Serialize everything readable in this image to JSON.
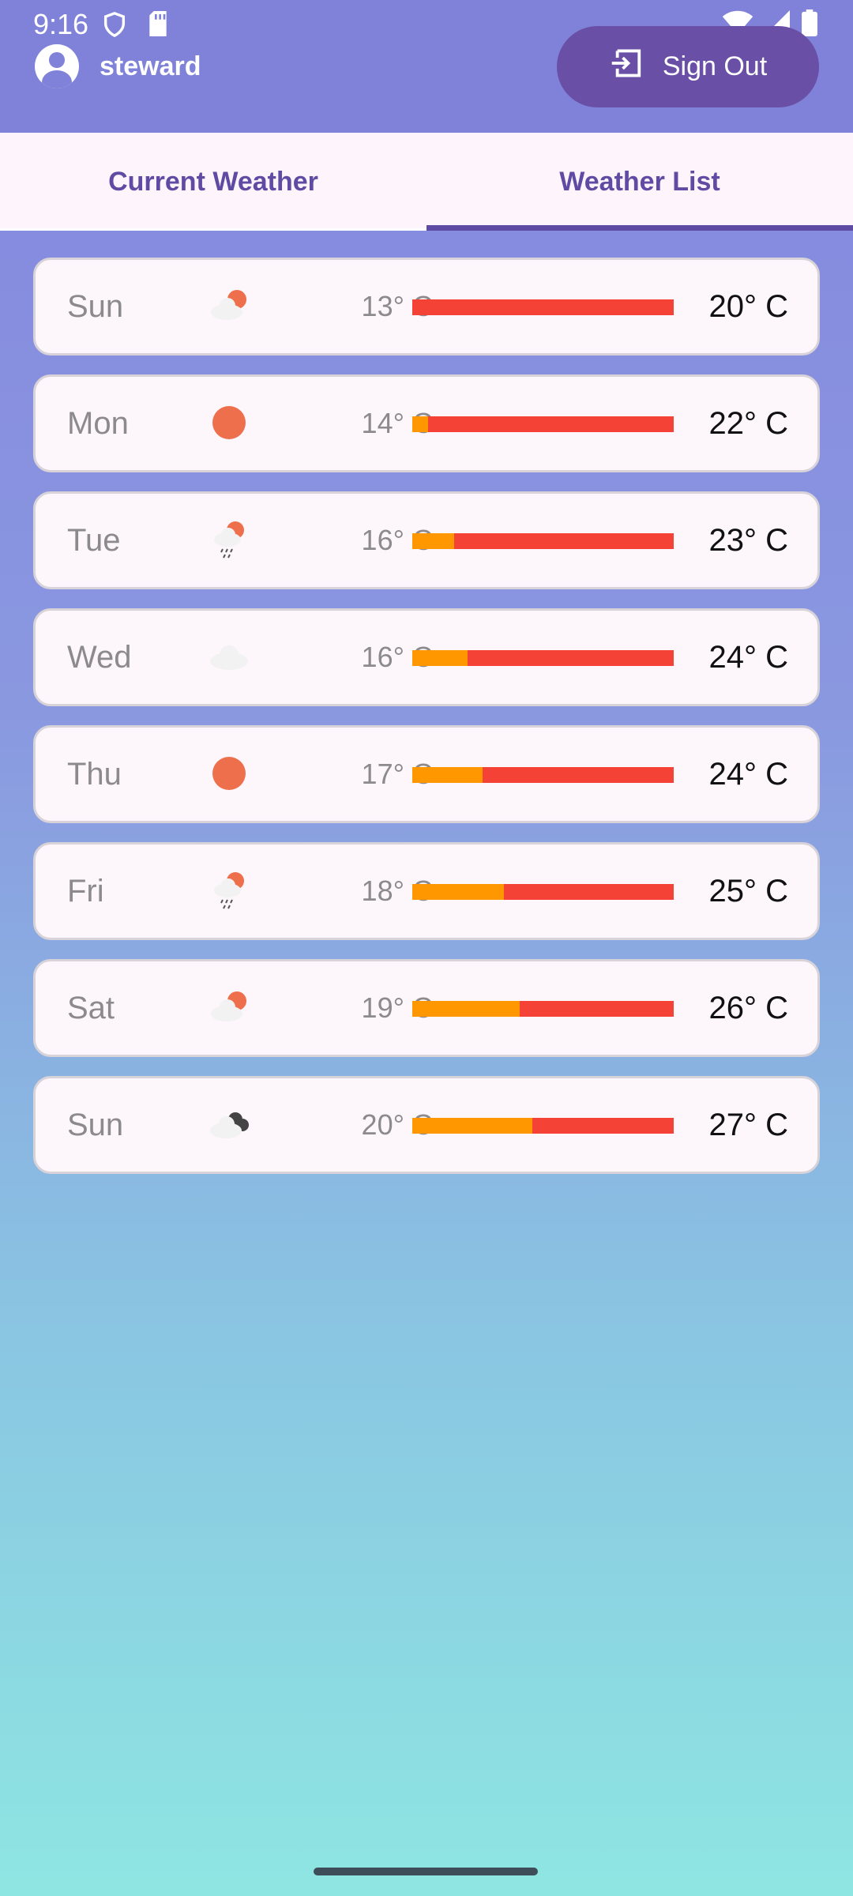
{
  "status_bar": {
    "time": "9:16",
    "icons": [
      "shield-icon",
      "sd-card-icon",
      "wifi-icon",
      "signal-icon",
      "battery-icon"
    ]
  },
  "header": {
    "username": "steward",
    "sign_out_label": "Sign Out"
  },
  "tabs": [
    {
      "label": "Current Weather",
      "selected": false
    },
    {
      "label": "Weather List",
      "selected": true
    }
  ],
  "colors": {
    "accent": "#5F4BA3",
    "bar_high": "#F44336",
    "bar_low": "#FF9800"
  },
  "forecast": [
    {
      "day": "Sun",
      "icon": "partly-cloudy-icon",
      "low": "13° C",
      "high": "20° C",
      "low_fraction": 0.0
    },
    {
      "day": "Mon",
      "icon": "sun-icon",
      "low": "14° C",
      "high": "22° C",
      "low_fraction": 0.06
    },
    {
      "day": "Tue",
      "icon": "rain-sun-icon",
      "low": "16° C",
      "high": "23° C",
      "low_fraction": 0.16
    },
    {
      "day": "Wed",
      "icon": "cloud-icon",
      "low": "16° C",
      "high": "24° C",
      "low_fraction": 0.21
    },
    {
      "day": "Thu",
      "icon": "sun-icon",
      "low": "17° C",
      "high": "24° C",
      "low_fraction": 0.27
    },
    {
      "day": "Fri",
      "icon": "rain-sun-icon",
      "low": "18° C",
      "high": "25° C",
      "low_fraction": 0.35
    },
    {
      "day": "Sat",
      "icon": "partly-cloudy-icon",
      "low": "19° C",
      "high": "26° C",
      "low_fraction": 0.41
    },
    {
      "day": "Sun",
      "icon": "storm-cloud-icon",
      "low": "20° C",
      "high": "27° C",
      "low_fraction": 0.46
    }
  ]
}
